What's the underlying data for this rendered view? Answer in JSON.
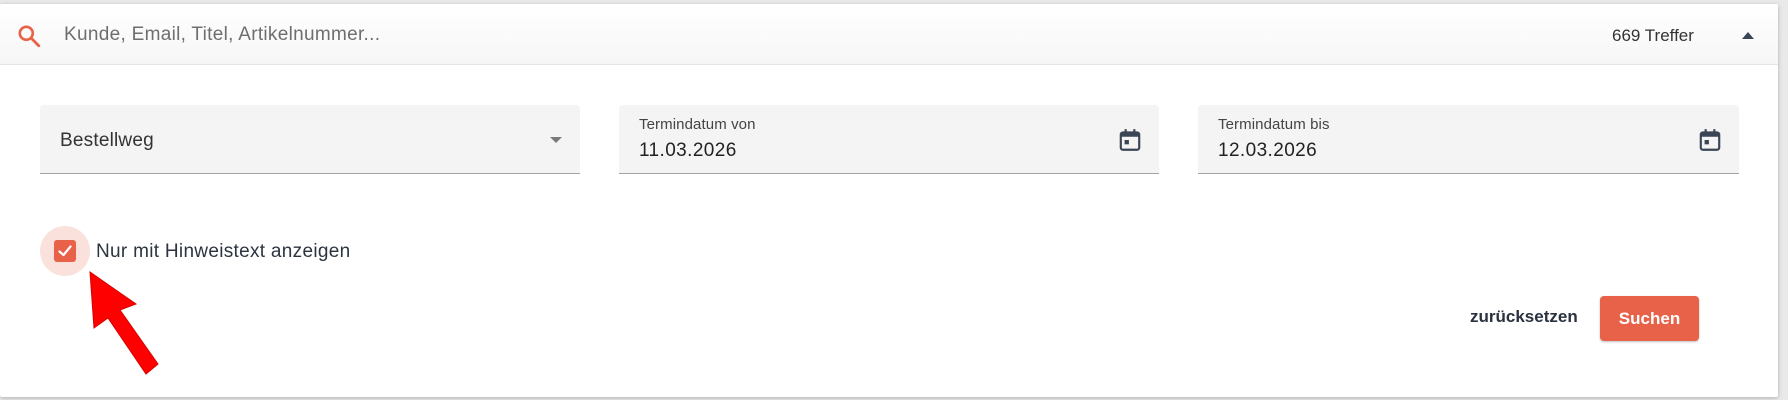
{
  "search": {
    "placeholder": "Kunde, Email, Titel, Artikelnummer...",
    "value": "",
    "hits_label": "669 Treffer",
    "icon": "search-icon",
    "collapse_icon": "caret-up-icon"
  },
  "filters": {
    "order_channel": {
      "label": "Bestellweg",
      "selected": ""
    },
    "date_from": {
      "label": "Termindatum von",
      "value": "11.03.2026",
      "icon": "calendar-icon"
    },
    "date_to": {
      "label": "Termindatum bis",
      "value": "12.03.2026",
      "icon": "calendar-icon"
    },
    "note_only": {
      "label": "Nur mit Hinweistext anzeigen",
      "checked": true
    }
  },
  "actions": {
    "reset_label": "zurücksetzen",
    "search_label": "Suchen"
  },
  "colors": {
    "accent": "#e8624a",
    "checkbox_halo": "#fbe1dc",
    "annotation_arrow": "#ff0000",
    "text_dark": "#2c3440"
  }
}
